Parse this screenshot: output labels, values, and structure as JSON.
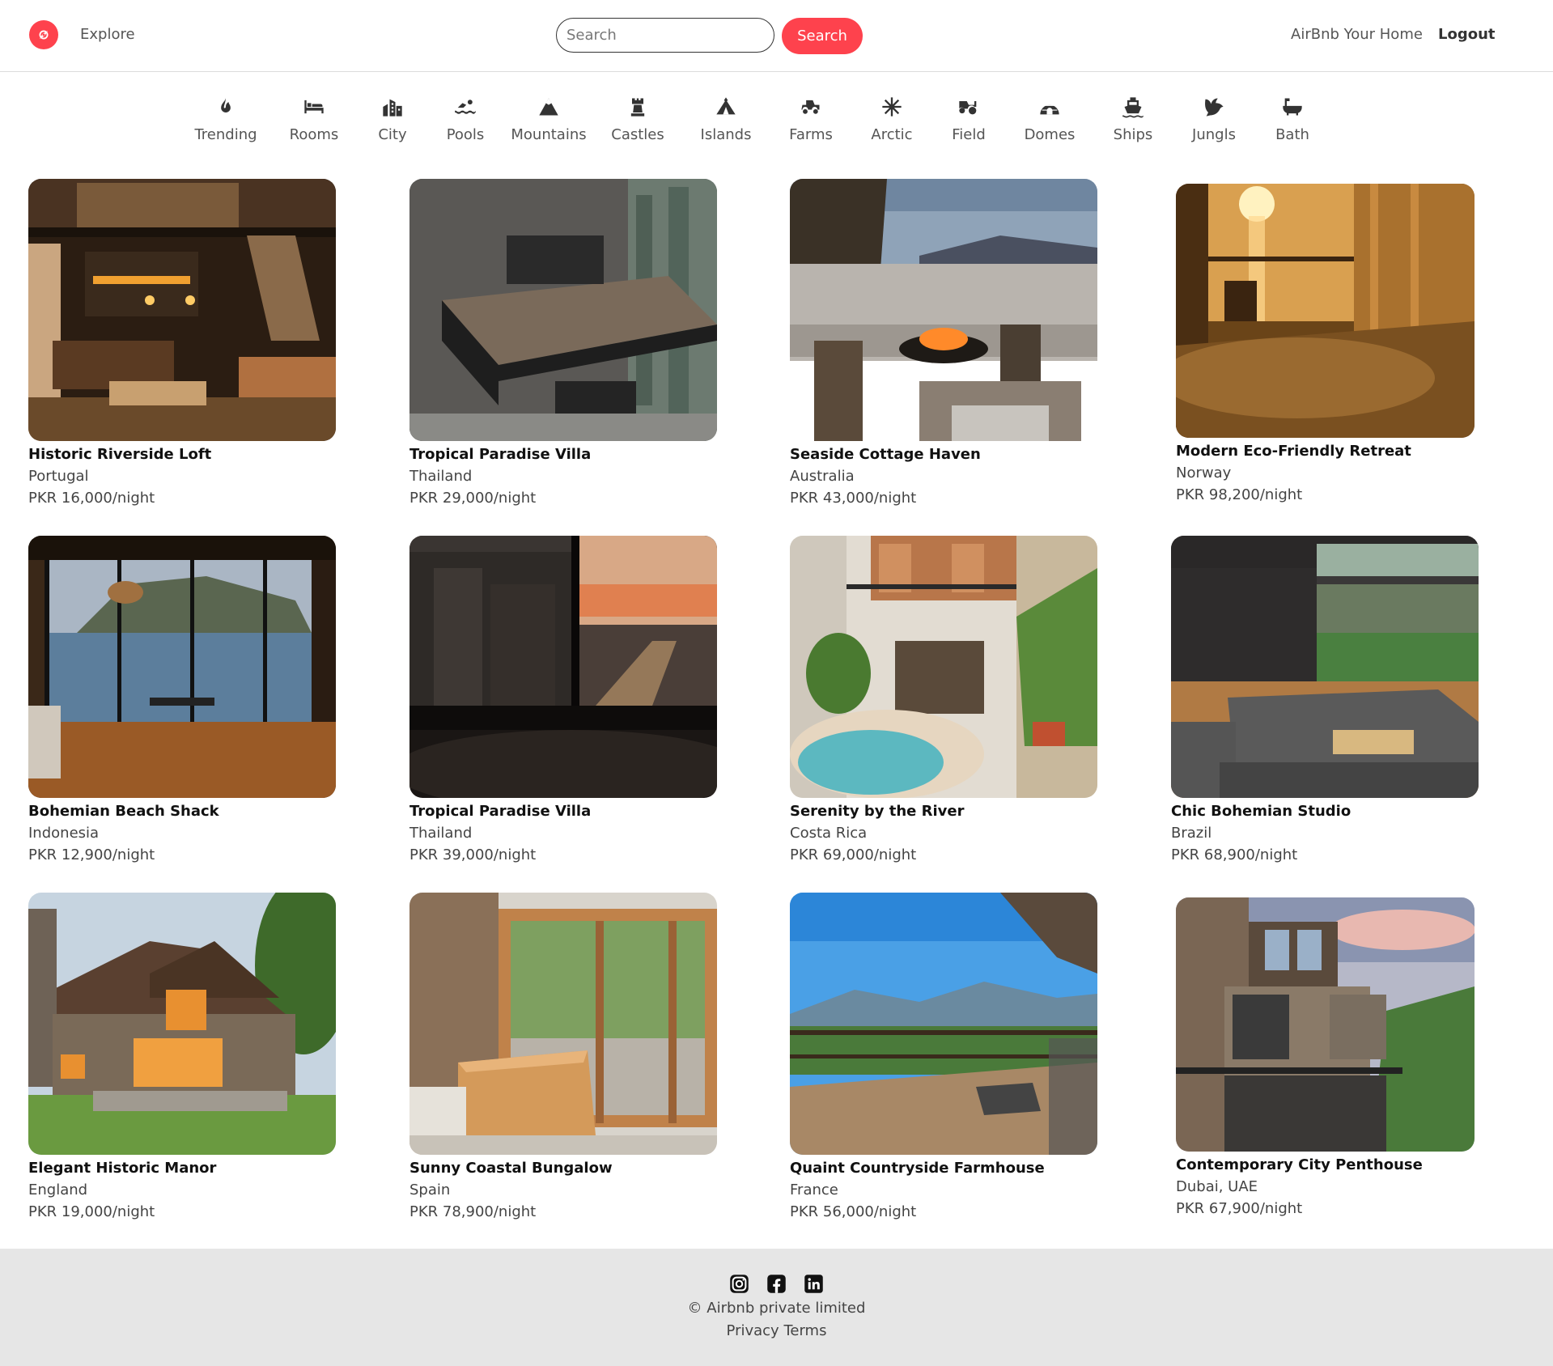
{
  "brand": {
    "color": "#fe424d",
    "logo_icon": "compass-icon"
  },
  "nav": {
    "explore": "Explore",
    "search_placeholder": "Search",
    "search_button": "Search",
    "your_home": "AirBnb Your Home",
    "logout": "Logout"
  },
  "filters": [
    {
      "label": "Trending",
      "icon": "fire-icon"
    },
    {
      "label": "Rooms",
      "icon": "bed-icon"
    },
    {
      "label": "City",
      "icon": "city-icon"
    },
    {
      "label": "Pools",
      "icon": "swimmer-icon"
    },
    {
      "label": "Mountains",
      "icon": "mountain-icon"
    },
    {
      "label": "Castles",
      "icon": "chess-rook-icon"
    },
    {
      "label": "Islands",
      "icon": "tent-icon"
    },
    {
      "label": "Farms",
      "icon": "tractor-icon"
    },
    {
      "label": "Arctic",
      "icon": "snowflake-icon"
    },
    {
      "label": "Field",
      "icon": "tractor-field-icon"
    },
    {
      "label": "Domes",
      "icon": "igloo-icon"
    },
    {
      "label": "Ships",
      "icon": "ship-icon"
    },
    {
      "label": "Jungls",
      "icon": "dove-icon"
    },
    {
      "label": "Bath",
      "icon": "bath-icon"
    }
  ],
  "listings": [
    {
      "title": "Historic Riverside Loft",
      "location": "Portugal",
      "price": "PKR 16,000/night"
    },
    {
      "title": "Tropical Paradise Villa",
      "location": "Thailand",
      "price": "PKR 29,000/night"
    },
    {
      "title": "Seaside Cottage Haven",
      "location": "Australia",
      "price": "PKR 43,000/night"
    },
    {
      "title": "Modern Eco-Friendly Retreat",
      "location": "Norway",
      "price": "PKR 98,200/night"
    },
    {
      "title": "Bohemian Beach Shack",
      "location": "Indonesia",
      "price": "PKR 12,900/night"
    },
    {
      "title": "Tropical Paradise Villa",
      "location": "Thailand",
      "price": "PKR 39,000/night"
    },
    {
      "title": "Serenity by the River",
      "location": "Costa Rica",
      "price": "PKR 69,000/night"
    },
    {
      "title": "Chic Bohemian Studio",
      "location": "Brazil",
      "price": "PKR 68,900/night"
    },
    {
      "title": "Elegant Historic Manor",
      "location": "England",
      "price": "PKR 19,000/night"
    },
    {
      "title": "Sunny Coastal Bungalow",
      "location": "Spain",
      "price": "PKR 78,900/night"
    },
    {
      "title": "Quaint Countryside Farmhouse",
      "location": "France",
      "price": "PKR 56,000/night"
    },
    {
      "title": "Contemporary City Penthouse",
      "location": "Dubai, UAE",
      "price": "PKR 67,900/night"
    }
  ],
  "footer": {
    "socials": [
      "instagram-icon",
      "facebook-icon",
      "linkedin-icon"
    ],
    "copyright": "© Airbnb private limited",
    "privacy": "Privacy",
    "terms": "Terms"
  }
}
